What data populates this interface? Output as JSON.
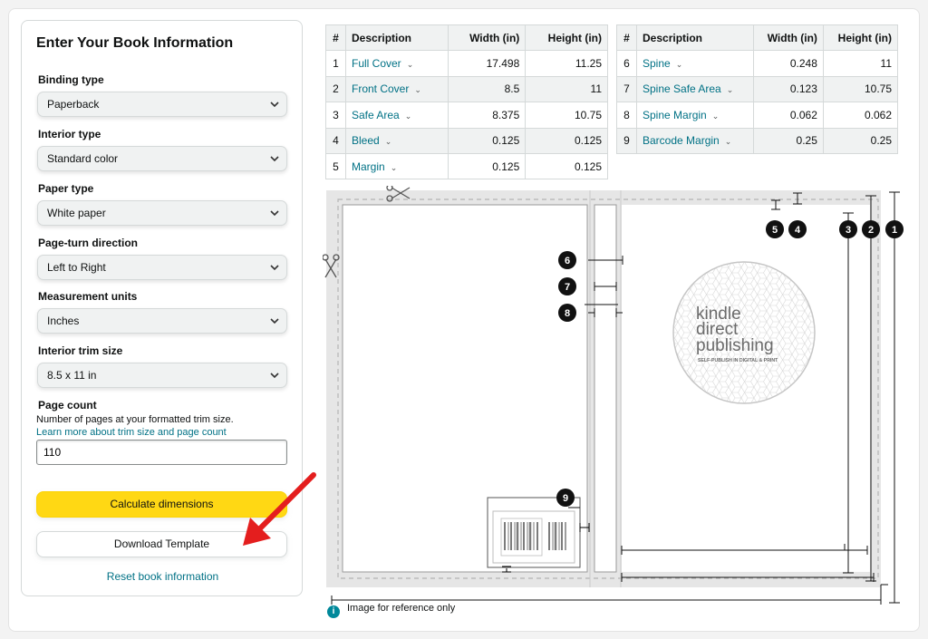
{
  "form": {
    "title": "Enter Your Book Information",
    "fields": [
      {
        "label": "Binding type",
        "value": "Paperback"
      },
      {
        "label": "Interior type",
        "value": "Standard color"
      },
      {
        "label": "Paper type",
        "value": "White paper"
      },
      {
        "label": "Page-turn direction",
        "value": "Left to Right"
      },
      {
        "label": "Measurement units",
        "value": "Inches"
      },
      {
        "label": "Interior trim size",
        "value": "8.5 x 11 in"
      }
    ],
    "page_count": {
      "label": "Page count",
      "help": "Number of pages at your formatted trim size.",
      "link": "Learn more about trim size and page count",
      "value": "110"
    },
    "calculate_label": "Calculate dimensions",
    "download_label": "Download Template",
    "reset_label": "Reset book information"
  },
  "tables": {
    "headers": {
      "num": "#",
      "desc": "Description",
      "width": "Width (in)",
      "height": "Height (in)"
    },
    "left": [
      {
        "n": "1",
        "desc": "Full Cover",
        "w": "17.498",
        "h": "11.25"
      },
      {
        "n": "2",
        "desc": "Front Cover",
        "w": "8.5",
        "h": "11"
      },
      {
        "n": "3",
        "desc": "Safe Area",
        "w": "8.375",
        "h": "10.75"
      },
      {
        "n": "4",
        "desc": "Bleed",
        "w": "0.125",
        "h": "0.125"
      },
      {
        "n": "5",
        "desc": "Margin",
        "w": "0.125",
        "h": "0.125"
      }
    ],
    "right": [
      {
        "n": "6",
        "desc": "Spine",
        "w": "0.248",
        "h": "11"
      },
      {
        "n": "7",
        "desc": "Spine Safe Area",
        "w": "0.123",
        "h": "10.75"
      },
      {
        "n": "8",
        "desc": "Spine Margin",
        "w": "0.062",
        "h": "0.062"
      },
      {
        "n": "9",
        "desc": "Barcode Margin",
        "w": "0.25",
        "h": "0.25"
      }
    ]
  },
  "diagram": {
    "logo_line1": "kindle",
    "logo_line2": "direct",
    "logo_line3": "publishing",
    "logo_tagline": "SELF-PUBLISH IN DIGITAL & PRINT",
    "markers": [
      "1",
      "2",
      "3",
      "4",
      "5",
      "6",
      "7",
      "8",
      "9"
    ],
    "caption": "Image for reference only",
    "info_glyph": "i",
    "annotation_arrow_color": "#e41e1e"
  }
}
